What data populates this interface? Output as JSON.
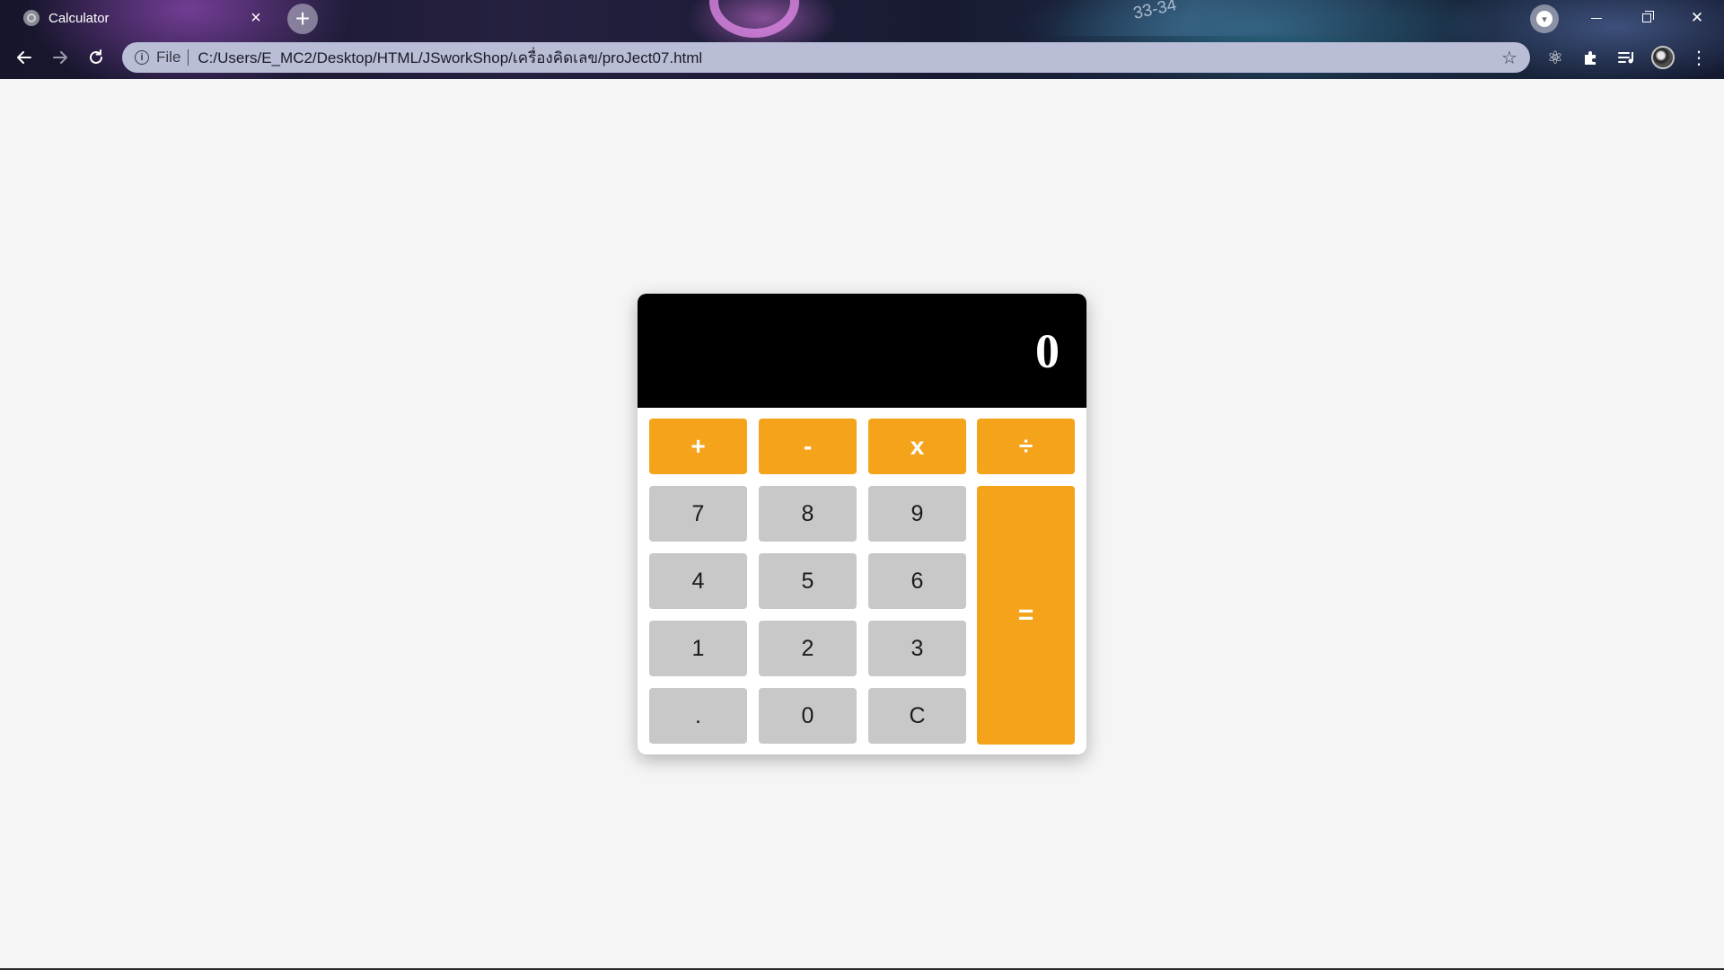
{
  "browser": {
    "tab": {
      "title": "Calculator",
      "close_icon": "×",
      "new_tab_icon": "+"
    },
    "window_controls": {
      "minimize_icon": "minimize-icon",
      "maximize_icon": "maximize-icon",
      "close_icon": "✕"
    },
    "toolbar": {
      "back_icon": "←",
      "forward_icon": "→",
      "reload_icon": "↻",
      "menu_icon": "⋮",
      "star_icon": "☆"
    },
    "address_bar": {
      "scheme_label": "File",
      "url": "C:/Users/E_MC2/Desktop/HTML/JSworkShop/เครื่องคิดเลข/proJect07.html"
    },
    "extensions": {
      "react_icon": "⚛",
      "puzzle_icon": "✚",
      "media_icon": "≡"
    },
    "background_art": {
      "number": "33-34"
    }
  },
  "calculator": {
    "display_value": "0",
    "operators": [
      "+",
      "-",
      "x",
      "÷"
    ],
    "digits": {
      "seven": "7",
      "eight": "8",
      "nine": "9",
      "four": "4",
      "five": "5",
      "six": "6",
      "one": "1",
      "two": "2",
      "three": "3",
      "zero": "0"
    },
    "decimal": ".",
    "clear": "C",
    "equals": "=",
    "colors": {
      "operator": "#f6a31c",
      "digit": "#c8c8c8",
      "display_bg": "#000000"
    }
  }
}
